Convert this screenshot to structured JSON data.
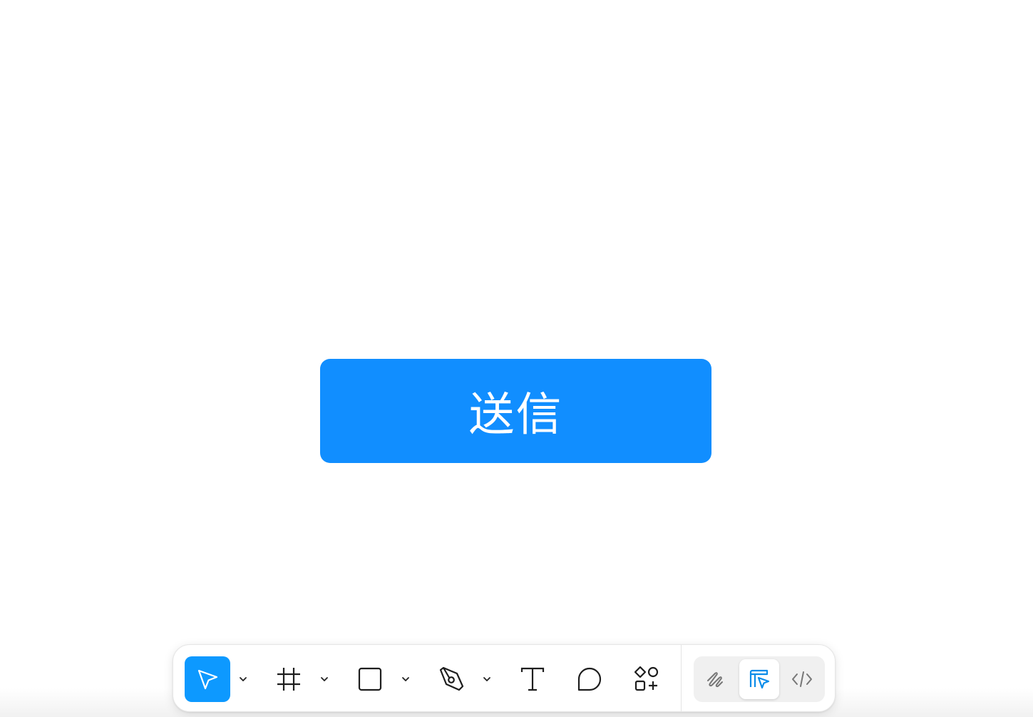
{
  "canvas": {
    "button": {
      "label": "送信",
      "background": "#118EFF",
      "text_color": "#FFFFFF"
    }
  },
  "toolbar": {
    "accent": "#0D99FF",
    "tools": [
      {
        "name": "move",
        "icon": "cursor-arrow-icon",
        "active": true,
        "has_dropdown": true
      },
      {
        "name": "frame",
        "icon": "frame-grid-icon",
        "active": false,
        "has_dropdown": true
      },
      {
        "name": "shape",
        "icon": "rectangle-icon",
        "active": false,
        "has_dropdown": true
      },
      {
        "name": "pen",
        "icon": "pen-nib-icon",
        "active": false,
        "has_dropdown": true
      },
      {
        "name": "text",
        "icon": "text-t-icon",
        "active": false,
        "has_dropdown": false
      },
      {
        "name": "comment",
        "icon": "comment-bubble-icon",
        "active": false,
        "has_dropdown": false
      },
      {
        "name": "actions",
        "icon": "shapes-plus-icon",
        "active": false,
        "has_dropdown": false
      }
    ],
    "modes": [
      {
        "name": "draw",
        "icon": "scribble-icon",
        "selected": false
      },
      {
        "name": "design",
        "icon": "design-layout-cursor-icon",
        "selected": true,
        "color": "#0C8CE9"
      },
      {
        "name": "dev",
        "icon": "code-brackets-icon",
        "selected": false
      }
    ]
  }
}
